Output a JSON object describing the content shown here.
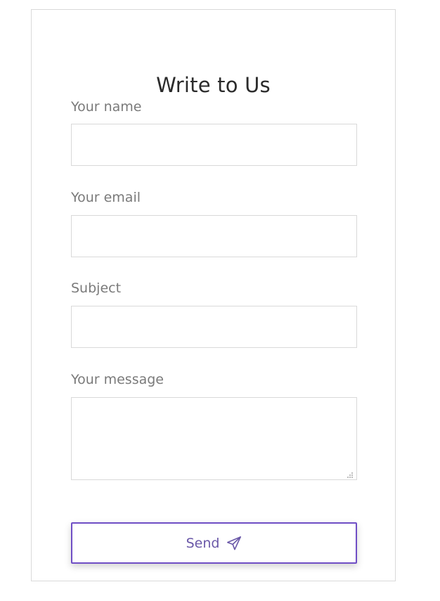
{
  "form": {
    "title": "Write to Us",
    "fields": {
      "name": {
        "label": "Your name",
        "value": ""
      },
      "email": {
        "label": "Your email",
        "value": ""
      },
      "subject": {
        "label": "Subject",
        "value": ""
      },
      "message": {
        "label": "Your message",
        "value": ""
      }
    },
    "send_label": "Send",
    "send_icon": "paper-plane-icon",
    "accent_color": "#6f4ec5"
  }
}
